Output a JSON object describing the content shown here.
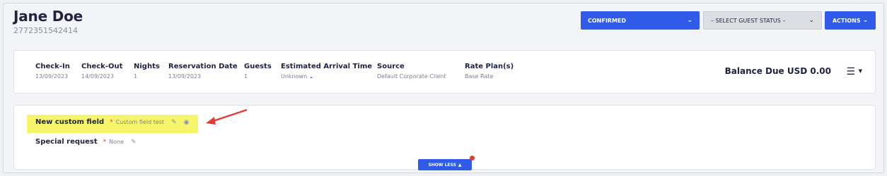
{
  "header": {
    "guest_name": "Jane Doe",
    "reservation_number": "2772351542414"
  },
  "toolbar": {
    "status_label": "CONFIRMED",
    "guest_status_label": "– SELECT GUEST STATUS –",
    "actions_label": "ACTIONS"
  },
  "reservation": {
    "columns": [
      {
        "label": "Check-In",
        "value": "13/09/2023"
      },
      {
        "label": "Check-Out",
        "value": "14/09/2023"
      },
      {
        "label": "Nights",
        "value": "1"
      },
      {
        "label": "Reservation Date",
        "value": "13/09/2023"
      },
      {
        "label": "Guests",
        "value": "1"
      },
      {
        "label": "Estimated Arrival Time",
        "value": "Unknown"
      },
      {
        "label": "Source",
        "value": "Default Corporate Client"
      },
      {
        "label": "Rate Plan(s)",
        "value": "Base Rate"
      }
    ],
    "balance": "Balance Due USD 0.00"
  },
  "custom_fields": [
    {
      "label": "New custom field",
      "required_mark": "*",
      "value": "Custom field test"
    },
    {
      "label": "Special request",
      "required_mark": "*",
      "value": "None"
    }
  ],
  "footer": {
    "show_less_label": "SHOW LESS"
  },
  "colors": {
    "primary": "#2f5be8",
    "highlight": "#f7f56b",
    "annotation_arrow": "#e53935"
  },
  "icons": {
    "status_dropdown": "chevron-down-icon",
    "actions_dropdown": "chevron-down-icon",
    "menu": "hamburger-icon",
    "edit": "pencil-icon",
    "visibility": "eye-slash-icon",
    "show_less": "caret-up-icon"
  }
}
